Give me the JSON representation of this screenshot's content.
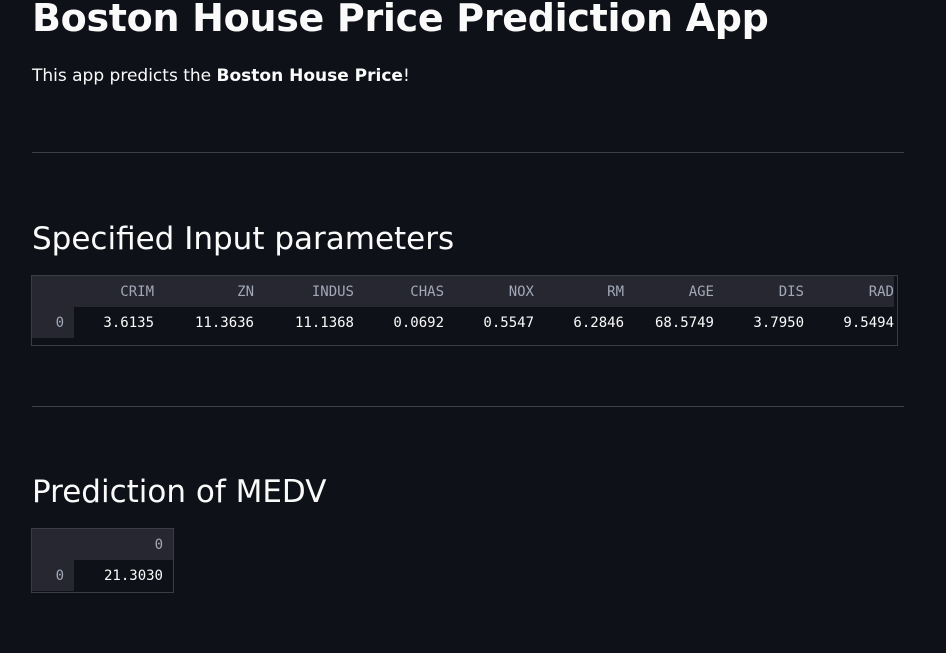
{
  "app": {
    "title": "Boston House Price Prediction App",
    "intro_prefix": "This app predicts the ",
    "intro_bold": "Boston House Price",
    "intro_suffix": "!"
  },
  "input_section": {
    "header": "Specified Input parameters",
    "columns": [
      "CRIM",
      "ZN",
      "INDUS",
      "CHAS",
      "NOX",
      "RM",
      "AGE",
      "DIS",
      "RAD"
    ],
    "rows": [
      {
        "index": "0",
        "values": [
          "3.6135",
          "11.3636",
          "11.1368",
          "0.0692",
          "0.5547",
          "6.2846",
          "68.5749",
          "3.7950",
          "9.5494"
        ]
      }
    ]
  },
  "prediction_section": {
    "header": "Prediction of MEDV",
    "columns": [
      "0"
    ],
    "rows": [
      {
        "index": "0",
        "values": [
          "21.3030"
        ]
      }
    ]
  }
}
